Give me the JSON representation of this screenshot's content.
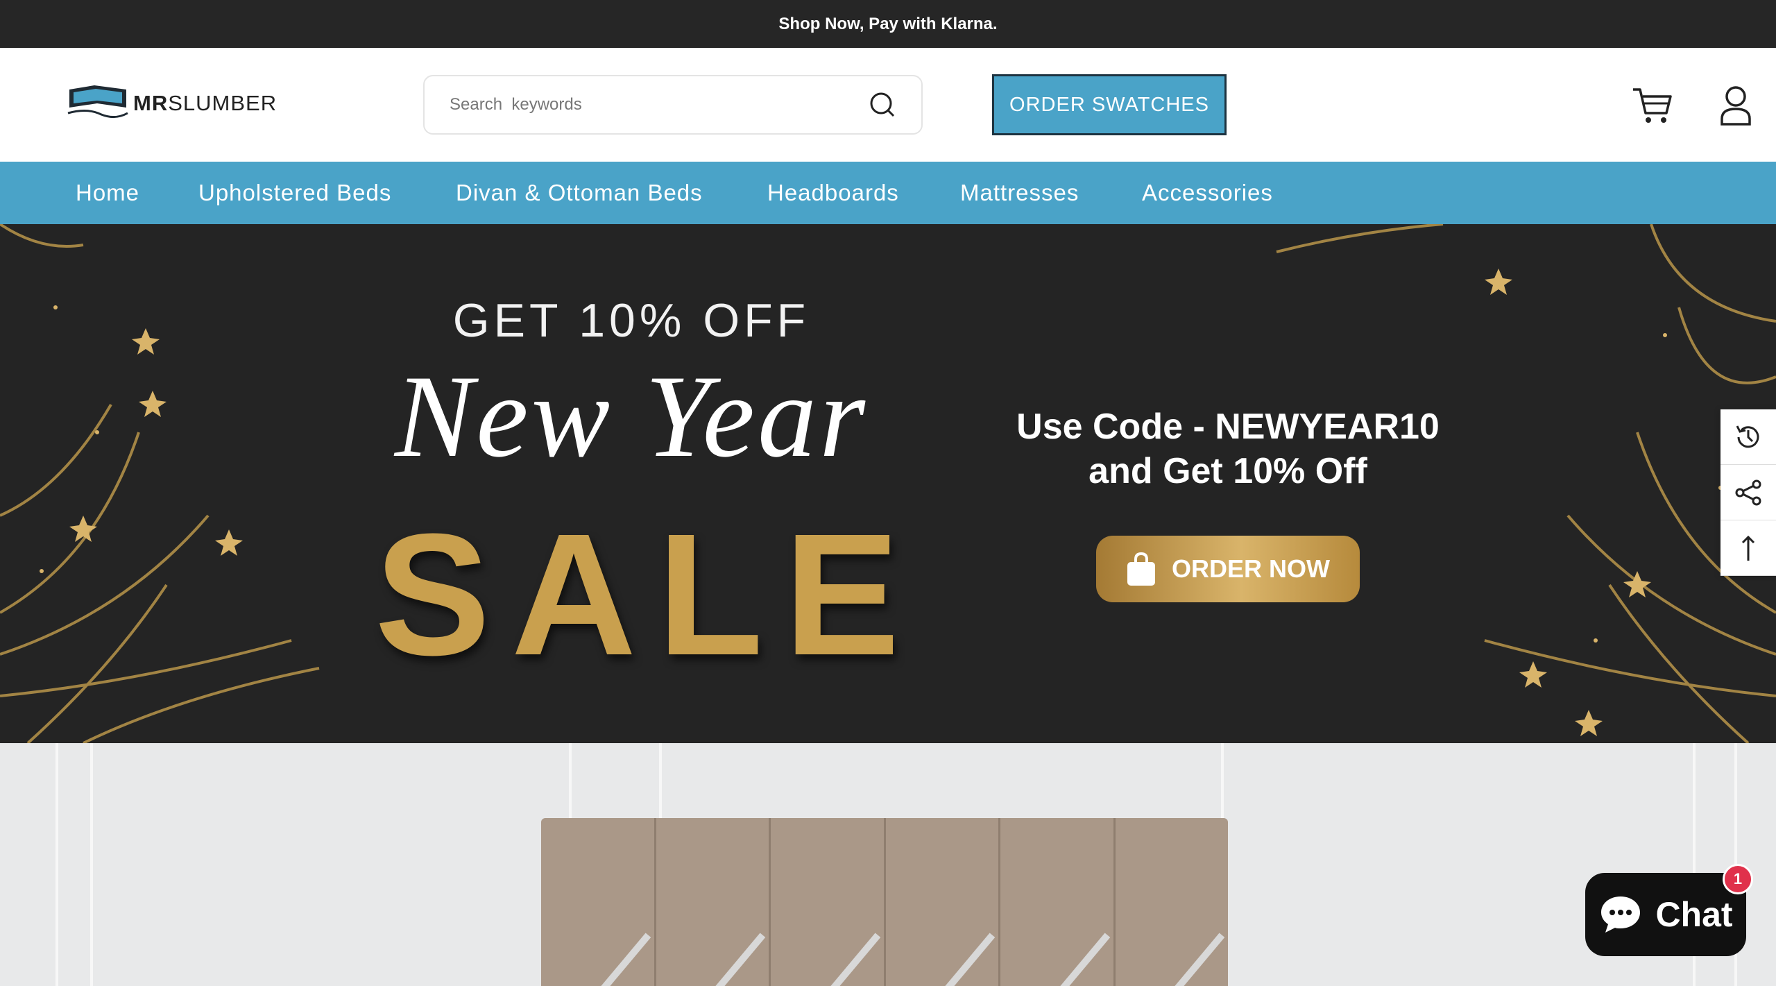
{
  "announcement": {
    "text": "Shop Now, Pay with Klarna."
  },
  "header": {
    "logo_bold": "MR",
    "logo_rest": "SLUMBER",
    "search_placeholder": "Search  keywords",
    "swatch_label": "ORDER SWATCHES"
  },
  "nav": {
    "items": [
      {
        "label": "Home"
      },
      {
        "label": "Upholstered Beds"
      },
      {
        "label": "Divan & Ottoman Beds"
      },
      {
        "label": "Headboards"
      },
      {
        "label": "Mattresses"
      },
      {
        "label": "Accessories"
      }
    ]
  },
  "banner": {
    "line1": "GET 10% OFF",
    "line2": "New Year",
    "line3": "SALE",
    "code_line1": "Use Code - NEWYEAR10",
    "code_line2": "and Get 10% Off",
    "cta_label": "ORDER NOW"
  },
  "side_tools": [
    "history-icon",
    "share-icon",
    "arrow-up-icon"
  ],
  "chat": {
    "label": "Chat",
    "badge": "1"
  },
  "colors": {
    "nav": "#4aa3c8",
    "announce": "#262626",
    "banner": "#242424",
    "gold": "#c9a04e",
    "chat": "#111111",
    "badge": "#e0314b"
  }
}
